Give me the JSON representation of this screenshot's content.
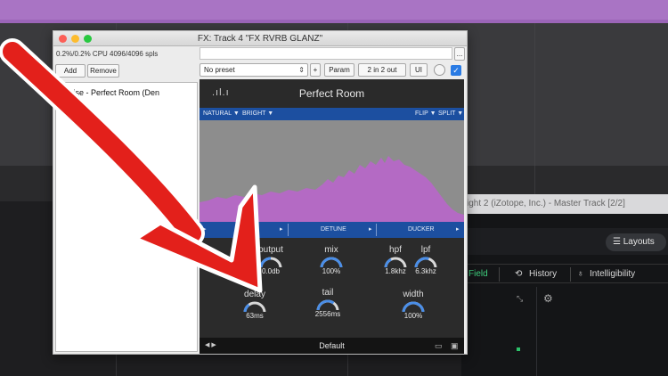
{
  "fx_window": {
    "title": "FX: Track 4 \"FX RVRB GLANZ\"",
    "cpu": "0.2%/0.2% CPU 4096/4096 spls",
    "add_label": "Add",
    "remove_label": "Remove",
    "plugin_item": "Denise - Perfect Room (Den",
    "preset_value": "No preset",
    "plus_label": "+",
    "param_label": "Param",
    "io_label": "2 in 2 out",
    "ui_label": "UI",
    "check_mark": "✓",
    "more_label": "..."
  },
  "plugin": {
    "name": "Perfect Room",
    "logo": ".ıl.ı",
    "top_bar": {
      "left1": "NATURAL ▼",
      "left2": "BRIGHT ▼",
      "right1": "FLIP ▼",
      "right2": "SPLIT ▼"
    },
    "tabs": [
      {
        "label": "▸"
      },
      {
        "label": "DETUNE"
      },
      {
        "label": "DUCKER"
      }
    ],
    "tab_arrows": [
      "▸",
      "▸",
      "▸"
    ],
    "knobs": [
      {
        "label": "output",
        "value": "0.0db",
        "level": 0.5
      },
      {
        "label": "mix",
        "value": "100%",
        "level": 1.0
      },
      {
        "label": "hpf",
        "value": "1.8khz",
        "level": 0.35
      },
      {
        "label": "lpf",
        "value": "6.3khz",
        "level": 0.6
      },
      {
        "label": "delay",
        "value": "63ms",
        "level": 0.3
      },
      {
        "label": "tail",
        "value": "2556ms",
        "level": 0.7
      },
      {
        "label": "width",
        "value": "100%",
        "level": 1.0
      }
    ],
    "footer": {
      "nav": "◀ ▶",
      "preset": "Default",
      "folder_icon": "▭",
      "save_icon": "▣"
    }
  },
  "ozone_window": {
    "title": "ight 2 (iZotope, Inc.) - Master Track [2/2]",
    "layouts_label": "☰  Layouts",
    "tabs": [
      "Field",
      "History",
      "Intelligibility"
    ],
    "gear": "⚙"
  },
  "colors": {
    "accent_blue": "#1c4fa0",
    "knob_arc": "#4a8ee8",
    "spectrum": "#b46ac4",
    "arrow_red": "#e3201b",
    "field_green": "#3fd07e"
  }
}
